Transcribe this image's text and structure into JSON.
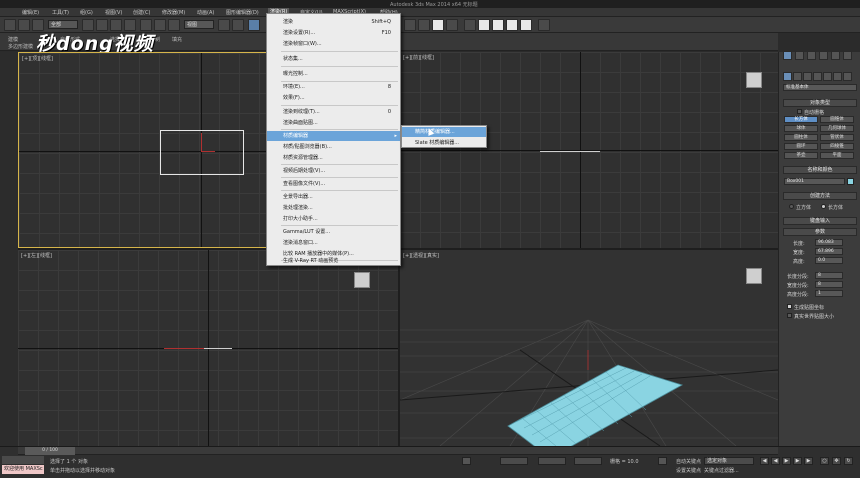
{
  "window": {
    "title": "Autodesk 3ds Max 2014 x64   无标题"
  },
  "menubar": {
    "items": [
      {
        "label": "编辑(E)"
      },
      {
        "label": "工具(T)"
      },
      {
        "label": "组(G)"
      },
      {
        "label": "视图(V)"
      },
      {
        "label": "创建(C)"
      },
      {
        "label": "修改器(M)"
      },
      {
        "label": "动画(A)"
      },
      {
        "label": "图形编辑器(D)"
      },
      {
        "label": "渲染(R)"
      },
      {
        "label": "自定义(U)"
      },
      {
        "label": "MAXScript(X)"
      },
      {
        "label": "帮助(H)"
      }
    ]
  },
  "toolbar": {
    "select_filter": "全部",
    "view_select": "视图"
  },
  "ribbon": {
    "tab1": "建模",
    "tab2": "自由形式",
    "tab3": "选择",
    "tab4": "对象绘制",
    "tab5": "填充",
    "sub": "多边形建模"
  },
  "logo": {
    "text": "秒dong视频"
  },
  "viewports": {
    "top_left_label": "[+][顶][线框]",
    "top_right_label": "[+][前][线框]",
    "bottom_left_label": "[+][左][线框]",
    "bottom_right_label": "[+][透视][真实]"
  },
  "render_menu": {
    "items": [
      {
        "label": "渲染",
        "shortcut": "Shift+Q"
      },
      {
        "label": "渲染设置(R)...",
        "shortcut": "F10"
      },
      {
        "label": "渲染帧窗口(W)...",
        "shortcut": ""
      },
      {
        "label": "状态集...",
        "shortcut": ""
      },
      {
        "label": "曝光控制...",
        "shortcut": ""
      },
      {
        "label": "环境(E)...",
        "shortcut": "8"
      },
      {
        "label": "效果(F)...",
        "shortcut": ""
      },
      {
        "label": "渲染到纹理(T)...",
        "shortcut": "0"
      },
      {
        "label": "渲染曲面贴图...",
        "shortcut": ""
      },
      {
        "label": "材质编辑器",
        "shortcut": ""
      },
      {
        "label": "材质/贴图浏览器(B)...",
        "shortcut": ""
      },
      {
        "label": "材质资源管理器...",
        "shortcut": ""
      },
      {
        "label": "视频后期处理(V)...",
        "shortcut": ""
      },
      {
        "label": "查看图像文件(V)...",
        "shortcut": ""
      },
      {
        "label": "全景导出器...",
        "shortcut": ""
      },
      {
        "label": "批处理渲染...",
        "shortcut": ""
      },
      {
        "label": "打印大小助手...",
        "shortcut": ""
      },
      {
        "label": "Gamma/LUT 设置...",
        "shortcut": ""
      },
      {
        "label": "渲染消息窗口...",
        "shortcut": ""
      },
      {
        "label": "比较 RAM 播放器中的媒体(P)...",
        "shortcut": ""
      },
      {
        "label": "生成 V-Ray RT 动画预览",
        "shortcut": ""
      }
    ],
    "submenu": [
      {
        "label": "精简材质编辑器..."
      },
      {
        "label": "Slate 材质编辑器..."
      }
    ]
  },
  "command_panel": {
    "category": "标准基本体",
    "object_type_title": "对象类型",
    "autogrid": "自动栅格",
    "buttons": [
      "长方体",
      "圆锥体",
      "球体",
      "几何球体",
      "圆柱体",
      "管状体",
      "圆环",
      "四棱锥",
      "茶壶",
      "平面"
    ],
    "name_color_title": "名称和颜色",
    "object_name": "Box001",
    "swatch_color": "#8ad4e2",
    "creation_method_title": "创建方法",
    "method_cube": "立方体",
    "method_box": "长方体",
    "keyboard_entry_title": "键盘输入",
    "params_title": "参数",
    "length_label": "长度:",
    "length_value": "96.083",
    "width_label": "宽度:",
    "width_value": "67.896",
    "height_label": "高度:",
    "height_value": "0.0",
    "length_segs_label": "长度分段:",
    "length_segs": "8",
    "width_segs_label": "宽度分段:",
    "width_segs": "8",
    "height_segs_label": "高度分段:",
    "height_segs": "1",
    "gen_uv": "生成贴图坐标",
    "real_world": "真实世界贴图大小"
  },
  "status": {
    "frame": "0 / 100",
    "selection": "选择了 1 个 对象",
    "prompt": "单击并拖动以选择并移动对象",
    "welcome": "欢迎使用 MAXSc",
    "grid": "栅格 = 10.0",
    "autokey": "自动关键点",
    "selected_obj": "选定对象",
    "setkey": "设置关键点",
    "keyfilter": "关键点过滤器..."
  },
  "colors": {
    "plane_fill": "#8ad4e2",
    "menu_highlight": "#6ba4d9",
    "viewport_active_border": "#d6b54a"
  }
}
